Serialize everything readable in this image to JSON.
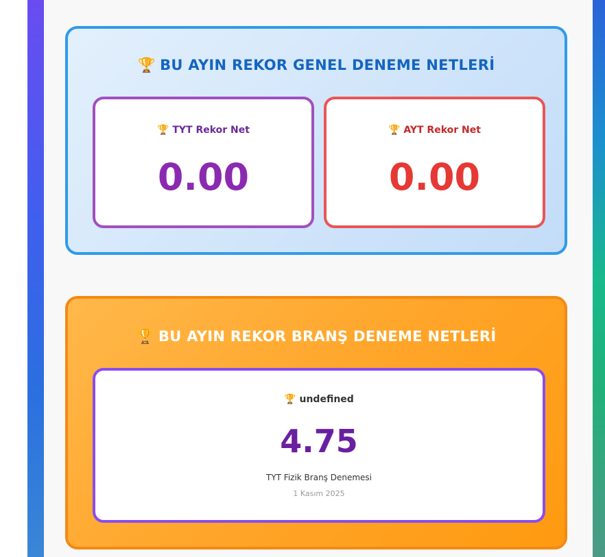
{
  "general": {
    "title": "BU AYIN REKOR GENEL DENEME NETLERİ",
    "tyt": {
      "label": "TYT Rekor Net",
      "value": "0.00"
    },
    "ayt": {
      "label": "AYT Rekor Net",
      "value": "0.00"
    }
  },
  "branch": {
    "title": "BU AYIN REKOR BRANŞ DENEME NETLERİ",
    "card": {
      "label": "undefined",
      "value": "4.75",
      "exam": "TYT Fizik Branş Denemesi",
      "date": "1 Kasım 2025"
    }
  },
  "icons": {
    "trophy": "trophy-icon"
  },
  "colors": {
    "general_border": "#2f9be8",
    "branch_border": "#f38a14",
    "tyt_accent": "#8a2ab0",
    "ayt_accent": "#e53935",
    "branch_value": "#6a1fa0"
  }
}
